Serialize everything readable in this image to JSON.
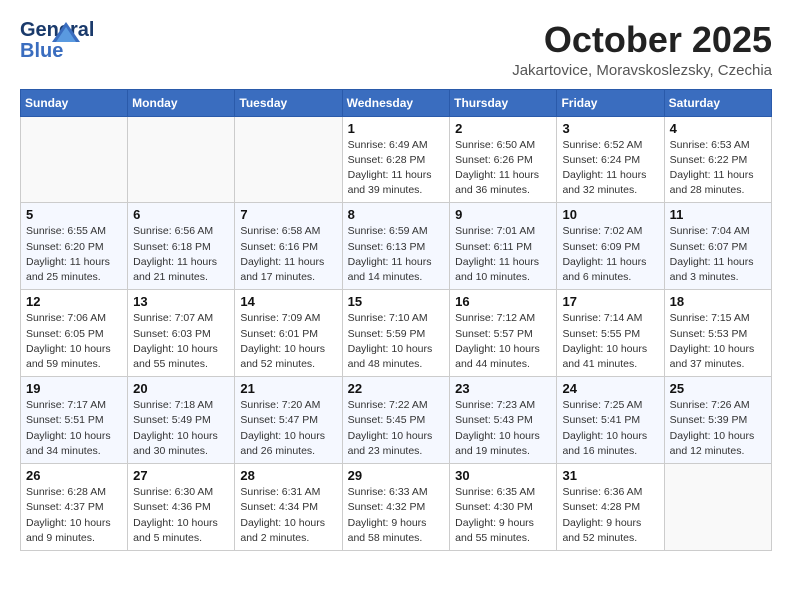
{
  "header": {
    "logo_line1": "General",
    "logo_line2": "Blue",
    "month_title": "October 2025",
    "location": "Jakartovice, Moravskoslezsky, Czechia"
  },
  "weekdays": [
    "Sunday",
    "Monday",
    "Tuesday",
    "Wednesday",
    "Thursday",
    "Friday",
    "Saturday"
  ],
  "weeks": [
    [
      {
        "day": "",
        "info": ""
      },
      {
        "day": "",
        "info": ""
      },
      {
        "day": "",
        "info": ""
      },
      {
        "day": "1",
        "info": "Sunrise: 6:49 AM\nSunset: 6:28 PM\nDaylight: 11 hours\nand 39 minutes."
      },
      {
        "day": "2",
        "info": "Sunrise: 6:50 AM\nSunset: 6:26 PM\nDaylight: 11 hours\nand 36 minutes."
      },
      {
        "day": "3",
        "info": "Sunrise: 6:52 AM\nSunset: 6:24 PM\nDaylight: 11 hours\nand 32 minutes."
      },
      {
        "day": "4",
        "info": "Sunrise: 6:53 AM\nSunset: 6:22 PM\nDaylight: 11 hours\nand 28 minutes."
      }
    ],
    [
      {
        "day": "5",
        "info": "Sunrise: 6:55 AM\nSunset: 6:20 PM\nDaylight: 11 hours\nand 25 minutes."
      },
      {
        "day": "6",
        "info": "Sunrise: 6:56 AM\nSunset: 6:18 PM\nDaylight: 11 hours\nand 21 minutes."
      },
      {
        "day": "7",
        "info": "Sunrise: 6:58 AM\nSunset: 6:16 PM\nDaylight: 11 hours\nand 17 minutes."
      },
      {
        "day": "8",
        "info": "Sunrise: 6:59 AM\nSunset: 6:13 PM\nDaylight: 11 hours\nand 14 minutes."
      },
      {
        "day": "9",
        "info": "Sunrise: 7:01 AM\nSunset: 6:11 PM\nDaylight: 11 hours\nand 10 minutes."
      },
      {
        "day": "10",
        "info": "Sunrise: 7:02 AM\nSunset: 6:09 PM\nDaylight: 11 hours\nand 6 minutes."
      },
      {
        "day": "11",
        "info": "Sunrise: 7:04 AM\nSunset: 6:07 PM\nDaylight: 11 hours\nand 3 minutes."
      }
    ],
    [
      {
        "day": "12",
        "info": "Sunrise: 7:06 AM\nSunset: 6:05 PM\nDaylight: 10 hours\nand 59 minutes."
      },
      {
        "day": "13",
        "info": "Sunrise: 7:07 AM\nSunset: 6:03 PM\nDaylight: 10 hours\nand 55 minutes."
      },
      {
        "day": "14",
        "info": "Sunrise: 7:09 AM\nSunset: 6:01 PM\nDaylight: 10 hours\nand 52 minutes."
      },
      {
        "day": "15",
        "info": "Sunrise: 7:10 AM\nSunset: 5:59 PM\nDaylight: 10 hours\nand 48 minutes."
      },
      {
        "day": "16",
        "info": "Sunrise: 7:12 AM\nSunset: 5:57 PM\nDaylight: 10 hours\nand 44 minutes."
      },
      {
        "day": "17",
        "info": "Sunrise: 7:14 AM\nSunset: 5:55 PM\nDaylight: 10 hours\nand 41 minutes."
      },
      {
        "day": "18",
        "info": "Sunrise: 7:15 AM\nSunset: 5:53 PM\nDaylight: 10 hours\nand 37 minutes."
      }
    ],
    [
      {
        "day": "19",
        "info": "Sunrise: 7:17 AM\nSunset: 5:51 PM\nDaylight: 10 hours\nand 34 minutes."
      },
      {
        "day": "20",
        "info": "Sunrise: 7:18 AM\nSunset: 5:49 PM\nDaylight: 10 hours\nand 30 minutes."
      },
      {
        "day": "21",
        "info": "Sunrise: 7:20 AM\nSunset: 5:47 PM\nDaylight: 10 hours\nand 26 minutes."
      },
      {
        "day": "22",
        "info": "Sunrise: 7:22 AM\nSunset: 5:45 PM\nDaylight: 10 hours\nand 23 minutes."
      },
      {
        "day": "23",
        "info": "Sunrise: 7:23 AM\nSunset: 5:43 PM\nDaylight: 10 hours\nand 19 minutes."
      },
      {
        "day": "24",
        "info": "Sunrise: 7:25 AM\nSunset: 5:41 PM\nDaylight: 10 hours\nand 16 minutes."
      },
      {
        "day": "25",
        "info": "Sunrise: 7:26 AM\nSunset: 5:39 PM\nDaylight: 10 hours\nand 12 minutes."
      }
    ],
    [
      {
        "day": "26",
        "info": "Sunrise: 6:28 AM\nSunset: 4:37 PM\nDaylight: 10 hours\nand 9 minutes."
      },
      {
        "day": "27",
        "info": "Sunrise: 6:30 AM\nSunset: 4:36 PM\nDaylight: 10 hours\nand 5 minutes."
      },
      {
        "day": "28",
        "info": "Sunrise: 6:31 AM\nSunset: 4:34 PM\nDaylight: 10 hours\nand 2 minutes."
      },
      {
        "day": "29",
        "info": "Sunrise: 6:33 AM\nSunset: 4:32 PM\nDaylight: 9 hours\nand 58 minutes."
      },
      {
        "day": "30",
        "info": "Sunrise: 6:35 AM\nSunset: 4:30 PM\nDaylight: 9 hours\nand 55 minutes."
      },
      {
        "day": "31",
        "info": "Sunrise: 6:36 AM\nSunset: 4:28 PM\nDaylight: 9 hours\nand 52 minutes."
      },
      {
        "day": "",
        "info": ""
      }
    ]
  ]
}
